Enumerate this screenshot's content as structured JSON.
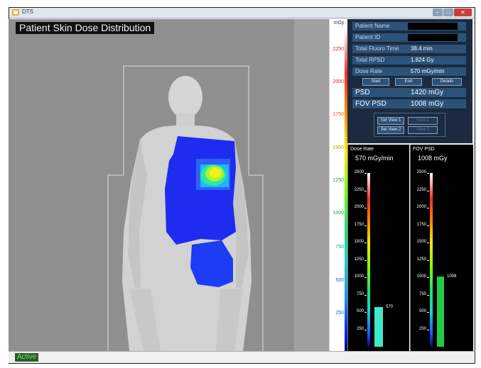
{
  "window": {
    "title": "DTS"
  },
  "scene": {
    "title": "Patient Skin Dose Distribution"
  },
  "color_scale": {
    "unit": "mGy",
    "ticks": [
      "2250",
      "2000",
      "1750",
      "1500",
      "1250",
      "1000",
      "750",
      "500",
      "250"
    ],
    "tick_colors": [
      "#d42020",
      "#d42020",
      "#e06000",
      "#c0a000",
      "#20a040",
      "#20a060",
      "#10a0a0",
      "#2060ff",
      "#2060ff"
    ]
  },
  "info": {
    "patient_name_label": "Patient Name",
    "patient_id_label": "Patient ID",
    "fluoro_time_label": "Total Fluoro Time",
    "fluoro_time_value": "38.4 min",
    "rpsd_label": "Total RPSD",
    "rpsd_value": "1.824 Gy",
    "dose_rate_label": "Dose Rate",
    "dose_rate_value": "570 mGy/min",
    "psd_label": "PSD",
    "psd_value": "1420 mGy",
    "fov_psd_label": "FOV PSD",
    "fov_psd_value": "1008 mGy"
  },
  "buttons": {
    "start": "Start",
    "end": "End",
    "details": "Details",
    "set_view_1": "Set View 1",
    "set_view_2": "Set View 2",
    "view_1": "View 1",
    "view_2": "View 2"
  },
  "graphs": {
    "dose_rate": {
      "label": "Dose Rate",
      "value": "570 mGy/min",
      "bar_value": 570,
      "bar_label": "570",
      "bar_color": "#3ee8c8"
    },
    "fov_psd": {
      "label": "FOV PSD",
      "value": "1008 mGy",
      "bar_value": 1008,
      "bar_label": "1008",
      "bar_color": "#22cc44"
    },
    "ticks": [
      "2500",
      "2250",
      "2000",
      "1750",
      "1500",
      "1250",
      "1000",
      "750",
      "500",
      "250"
    ],
    "max": 2500
  },
  "status": {
    "text": "Active"
  }
}
